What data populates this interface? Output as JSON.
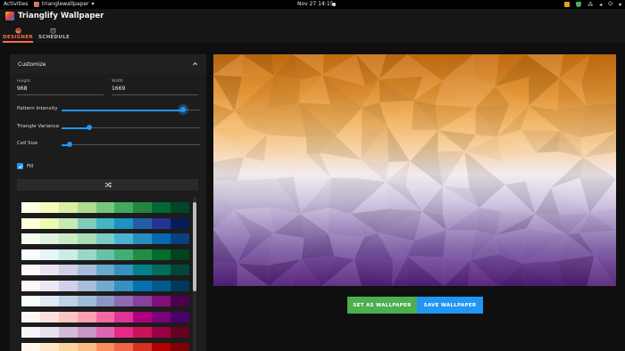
{
  "topbar": {
    "activities": "Activities",
    "app_menu": "trianglewallpaper",
    "clock": "Nov 27  14:15"
  },
  "app": {
    "title": "Trianglify Wallpaper",
    "tabs": [
      {
        "label": "DESIGNER",
        "active": true
      },
      {
        "label": "SCHEDULE",
        "active": false
      }
    ]
  },
  "customize": {
    "title": "Customize",
    "height_label": "Height",
    "height_value": "968",
    "width_label": "Width",
    "width_value": "1669",
    "sliders": [
      {
        "label": "Pattern Intensity",
        "value": 0.88
      },
      {
        "label": "Triangle Variance",
        "value": 0.2
      },
      {
        "label": "Cell Size",
        "value": 0.06
      }
    ],
    "fill_label": "Fill",
    "fill_checked": true
  },
  "palettes": [
    [
      "#ffffe5",
      "#f7fcb9",
      "#d9f0a3",
      "#addd8e",
      "#78c679",
      "#41ab5d",
      "#238443",
      "#006837",
      "#004529"
    ],
    [
      "#ffffd9",
      "#edf8b1",
      "#c7e9b4",
      "#7fcdbb",
      "#41b6c4",
      "#1d91c0",
      "#225ea8",
      "#253494",
      "#081d58"
    ],
    [
      "#f7fcf0",
      "#e0f3db",
      "#ccebc5",
      "#a8ddb5",
      "#7bccc4",
      "#4eb3d3",
      "#2b8cbe",
      "#0868ac",
      "#084081"
    ],
    [
      "#f7fcfd",
      "#e5f5f9",
      "#ccece6",
      "#99d8c9",
      "#66c2a4",
      "#41ae76",
      "#238b45",
      "#006d2c",
      "#00441b"
    ],
    [
      "#fff7fb",
      "#ece2f0",
      "#d0d1e6",
      "#a6bddb",
      "#67a9cf",
      "#3690c0",
      "#02818a",
      "#016c59",
      "#014636"
    ],
    [
      "#fff7fb",
      "#ece7f2",
      "#d0d1e6",
      "#a6bddb",
      "#74a9cf",
      "#3690c0",
      "#0570b0",
      "#045a8d",
      "#023858"
    ],
    [
      "#f7fcfd",
      "#e0ecf4",
      "#bfd3e6",
      "#9ebcda",
      "#8c96c6",
      "#8c6bb1",
      "#88419d",
      "#810f7c",
      "#4d004b"
    ],
    [
      "#fff7f3",
      "#fde0dd",
      "#fcc5c0",
      "#fa9fb5",
      "#f768a1",
      "#dd3497",
      "#ae017e",
      "#7a0177",
      "#49006a"
    ],
    [
      "#f7f4f9",
      "#e7e1ef",
      "#d4b9da",
      "#c994c7",
      "#df65b0",
      "#e7298a",
      "#ce1256",
      "#980043",
      "#67001f"
    ],
    [
      "#fff7ec",
      "#fee8c8",
      "#fdd49e",
      "#fdbb84",
      "#fc8d59",
      "#ef6548",
      "#d7301f",
      "#b30000",
      "#7f0000"
    ]
  ],
  "actions": {
    "set_wallpaper": "SET AS WALLPAPER",
    "save_wallpaper": "SAVE WALLPAPER"
  },
  "colors": {
    "accent": "#2196f3",
    "tab_active": "#ff6b4a",
    "set_button": "#4caf50",
    "save_button": "#2196f3"
  }
}
